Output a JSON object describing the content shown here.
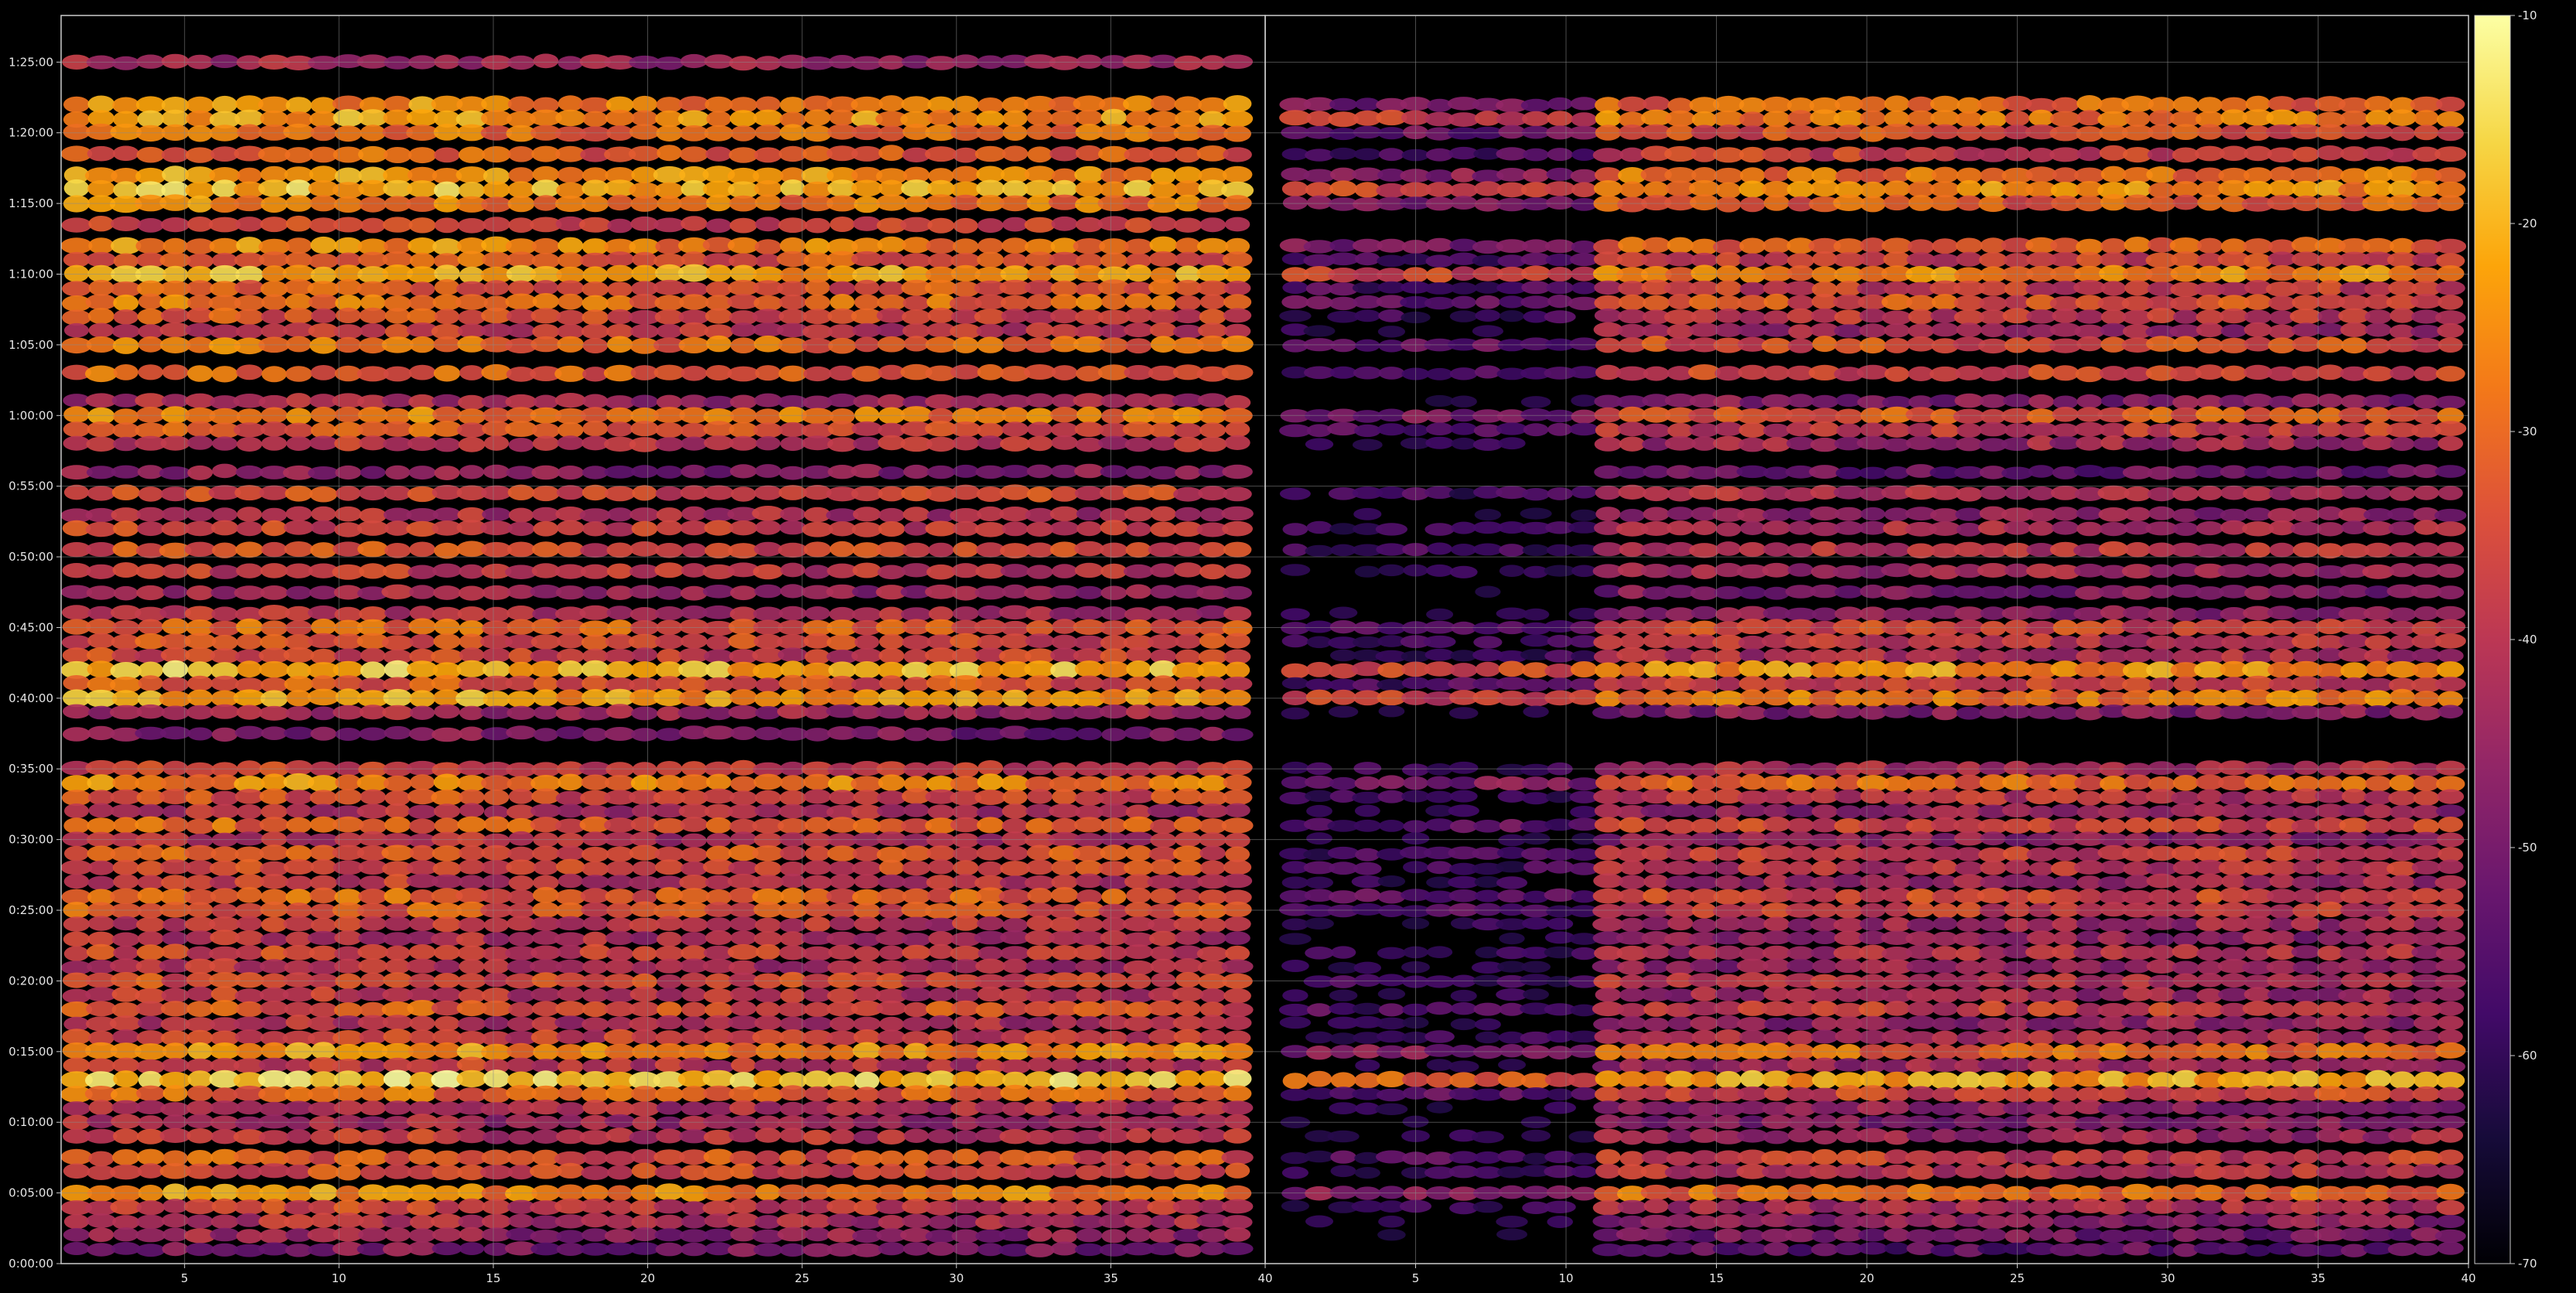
{
  "chart_data": {
    "type": "heatmap",
    "title": "",
    "xlabel": "",
    "ylabel": "",
    "grid": true,
    "legend": "colorbar-right",
    "colormap": "inferno",
    "colors": {
      "background": "#000000",
      "grid": "#8a8a8a",
      "axis": "#cccccc",
      "text": "#e6e6e6"
    },
    "panels": [
      {
        "name": "left",
        "x_range": [
          1,
          40
        ],
        "x_ticks": [
          "5",
          "10",
          "15",
          "20",
          "25",
          "30",
          "35",
          "40"
        ],
        "x_tick_values": [
          5,
          10,
          15,
          20,
          25,
          30,
          35,
          40
        ]
      },
      {
        "name": "right",
        "x_range": [
          0,
          40
        ],
        "x_ticks": [
          "5",
          "10",
          "15",
          "20",
          "25",
          "30",
          "35",
          "40"
        ],
        "x_tick_values": [
          5,
          10,
          15,
          20,
          25,
          30,
          35,
          40
        ]
      }
    ],
    "y_range_minutes": [
      0,
      88.3
    ],
    "y_ticks": [
      "0:00:00",
      "0:05:00",
      "0:10:00",
      "0:15:00",
      "0:20:00",
      "0:25:00",
      "0:30:00",
      "0:35:00",
      "0:40:00",
      "0:45:00",
      "0:50:00",
      "0:55:00",
      "1:00:00",
      "1:05:00",
      "1:10:00",
      "1:15:00",
      "1:20:00",
      "1:25:00"
    ],
    "y_tick_minutes": [
      0,
      5,
      10,
      15,
      20,
      25,
      30,
      35,
      40,
      45,
      50,
      55,
      60,
      65,
      70,
      75,
      80,
      85
    ],
    "colorbar": {
      "range": [
        -70,
        -10
      ],
      "ticks": [
        "-10",
        "-20",
        "-30",
        "-40",
        "-50",
        "-60",
        "-70"
      ],
      "tick_values": [
        -10,
        -20,
        -30,
        -40,
        -50,
        -60,
        -70
      ]
    },
    "intensity_rows_minutes": [
      {
        "t": 85.0,
        "lv": -45,
        "ext": "left"
      },
      {
        "t": 82.0,
        "lv": -27,
        "ext": "both"
      },
      {
        "t": 81.0,
        "lv": -24,
        "ext": "both"
      },
      {
        "t": 80.0,
        "lv": -30,
        "ext": "both"
      },
      {
        "t": 78.5,
        "lv": -33,
        "ext": "both"
      },
      {
        "t": 77.0,
        "lv": -25,
        "ext": "both"
      },
      {
        "t": 76.0,
        "lv": -21,
        "ext": "both"
      },
      {
        "t": 75.0,
        "lv": -28,
        "ext": "both"
      },
      {
        "t": 73.5,
        "lv": -38,
        "ext": "left"
      },
      {
        "t": 72.0,
        "lv": -27,
        "ext": "both"
      },
      {
        "t": 71.0,
        "lv": -33,
        "ext": "both"
      },
      {
        "t": 70.0,
        "lv": -22,
        "ext": "both"
      },
      {
        "t": 69.0,
        "lv": -34,
        "ext": "both"
      },
      {
        "t": 68.0,
        "lv": -30,
        "ext": "both"
      },
      {
        "t": 67.0,
        "lv": -36,
        "ext": "both"
      },
      {
        "t": 66.0,
        "lv": -40,
        "ext": "both"
      },
      {
        "t": 65.0,
        "lv": -30,
        "ext": "both"
      },
      {
        "t": 63.0,
        "lv": -32,
        "ext": "both"
      },
      {
        "t": 61.0,
        "lv": -44,
        "ext": "both"
      },
      {
        "t": 60.0,
        "lv": -28,
        "ext": "both"
      },
      {
        "t": 59.0,
        "lv": -34,
        "ext": "both"
      },
      {
        "t": 58.0,
        "lv": -40,
        "ext": "both"
      },
      {
        "t": 56.0,
        "lv": -48,
        "ext": "both"
      },
      {
        "t": 54.5,
        "lv": -36,
        "ext": "both"
      },
      {
        "t": 53.0,
        "lv": -42,
        "ext": "both"
      },
      {
        "t": 52.0,
        "lv": -38,
        "ext": "both"
      },
      {
        "t": 50.5,
        "lv": -36,
        "ext": "both"
      },
      {
        "t": 49.0,
        "lv": -40,
        "ext": "both"
      },
      {
        "t": 47.5,
        "lv": -45,
        "ext": "both"
      },
      {
        "t": 46.0,
        "lv": -42,
        "ext": "both"
      },
      {
        "t": 45.0,
        "lv": -32,
        "ext": "both"
      },
      {
        "t": 44.0,
        "lv": -36,
        "ext": "both"
      },
      {
        "t": 43.0,
        "lv": -38,
        "ext": "both"
      },
      {
        "t": 42.0,
        "lv": -20,
        "ext": "both"
      },
      {
        "t": 41.0,
        "lv": -34,
        "ext": "both"
      },
      {
        "t": 40.0,
        "lv": -24,
        "ext": "both"
      },
      {
        "t": 39.0,
        "lv": -44,
        "ext": "both"
      },
      {
        "t": 37.5,
        "lv": -50,
        "ext": "left"
      },
      {
        "t": 35.0,
        "lv": -38,
        "ext": "both"
      },
      {
        "t": 34.0,
        "lv": -27,
        "ext": "both"
      },
      {
        "t": 33.0,
        "lv": -36,
        "ext": "both"
      },
      {
        "t": 32.0,
        "lv": -42,
        "ext": "both"
      },
      {
        "t": 31.0,
        "lv": -32,
        "ext": "both"
      },
      {
        "t": 30.0,
        "lv": -42,
        "ext": "both"
      },
      {
        "t": 29.0,
        "lv": -34,
        "ext": "both"
      },
      {
        "t": 28.0,
        "lv": -36,
        "ext": "both"
      },
      {
        "t": 27.0,
        "lv": -40,
        "ext": "both"
      },
      {
        "t": 26.0,
        "lv": -32,
        "ext": "both"
      },
      {
        "t": 25.0,
        "lv": -34,
        "ext": "both"
      },
      {
        "t": 24.0,
        "lv": -40,
        "ext": "both"
      },
      {
        "t": 23.0,
        "lv": -42,
        "ext": "both"
      },
      {
        "t": 22.0,
        "lv": -38,
        "ext": "both"
      },
      {
        "t": 21.0,
        "lv": -42,
        "ext": "both"
      },
      {
        "t": 20.0,
        "lv": -36,
        "ext": "both"
      },
      {
        "t": 19.0,
        "lv": -40,
        "ext": "both"
      },
      {
        "t": 18.0,
        "lv": -34,
        "ext": "both"
      },
      {
        "t": 17.0,
        "lv": -42,
        "ext": "both"
      },
      {
        "t": 16.0,
        "lv": -38,
        "ext": "both"
      },
      {
        "t": 15.0,
        "lv": -26,
        "ext": "both"
      },
      {
        "t": 14.0,
        "lv": -40,
        "ext": "both"
      },
      {
        "t": 13.0,
        "lv": -18,
        "ext": "both"
      },
      {
        "t": 12.0,
        "lv": -32,
        "ext": "both"
      },
      {
        "t": 11.0,
        "lv": -42,
        "ext": "both"
      },
      {
        "t": 10.0,
        "lv": -44,
        "ext": "both"
      },
      {
        "t": 9.0,
        "lv": -40,
        "ext": "both"
      },
      {
        "t": 7.5,
        "lv": -34,
        "ext": "both"
      },
      {
        "t": 6.5,
        "lv": -36,
        "ext": "both"
      },
      {
        "t": 5.0,
        "lv": -26,
        "ext": "both"
      },
      {
        "t": 4.0,
        "lv": -38,
        "ext": "both"
      },
      {
        "t": 3.0,
        "lv": -42,
        "ext": "both"
      },
      {
        "t": 2.0,
        "lv": -46,
        "ext": "both"
      },
      {
        "t": 1.0,
        "lv": -50,
        "ext": "both"
      }
    ]
  }
}
